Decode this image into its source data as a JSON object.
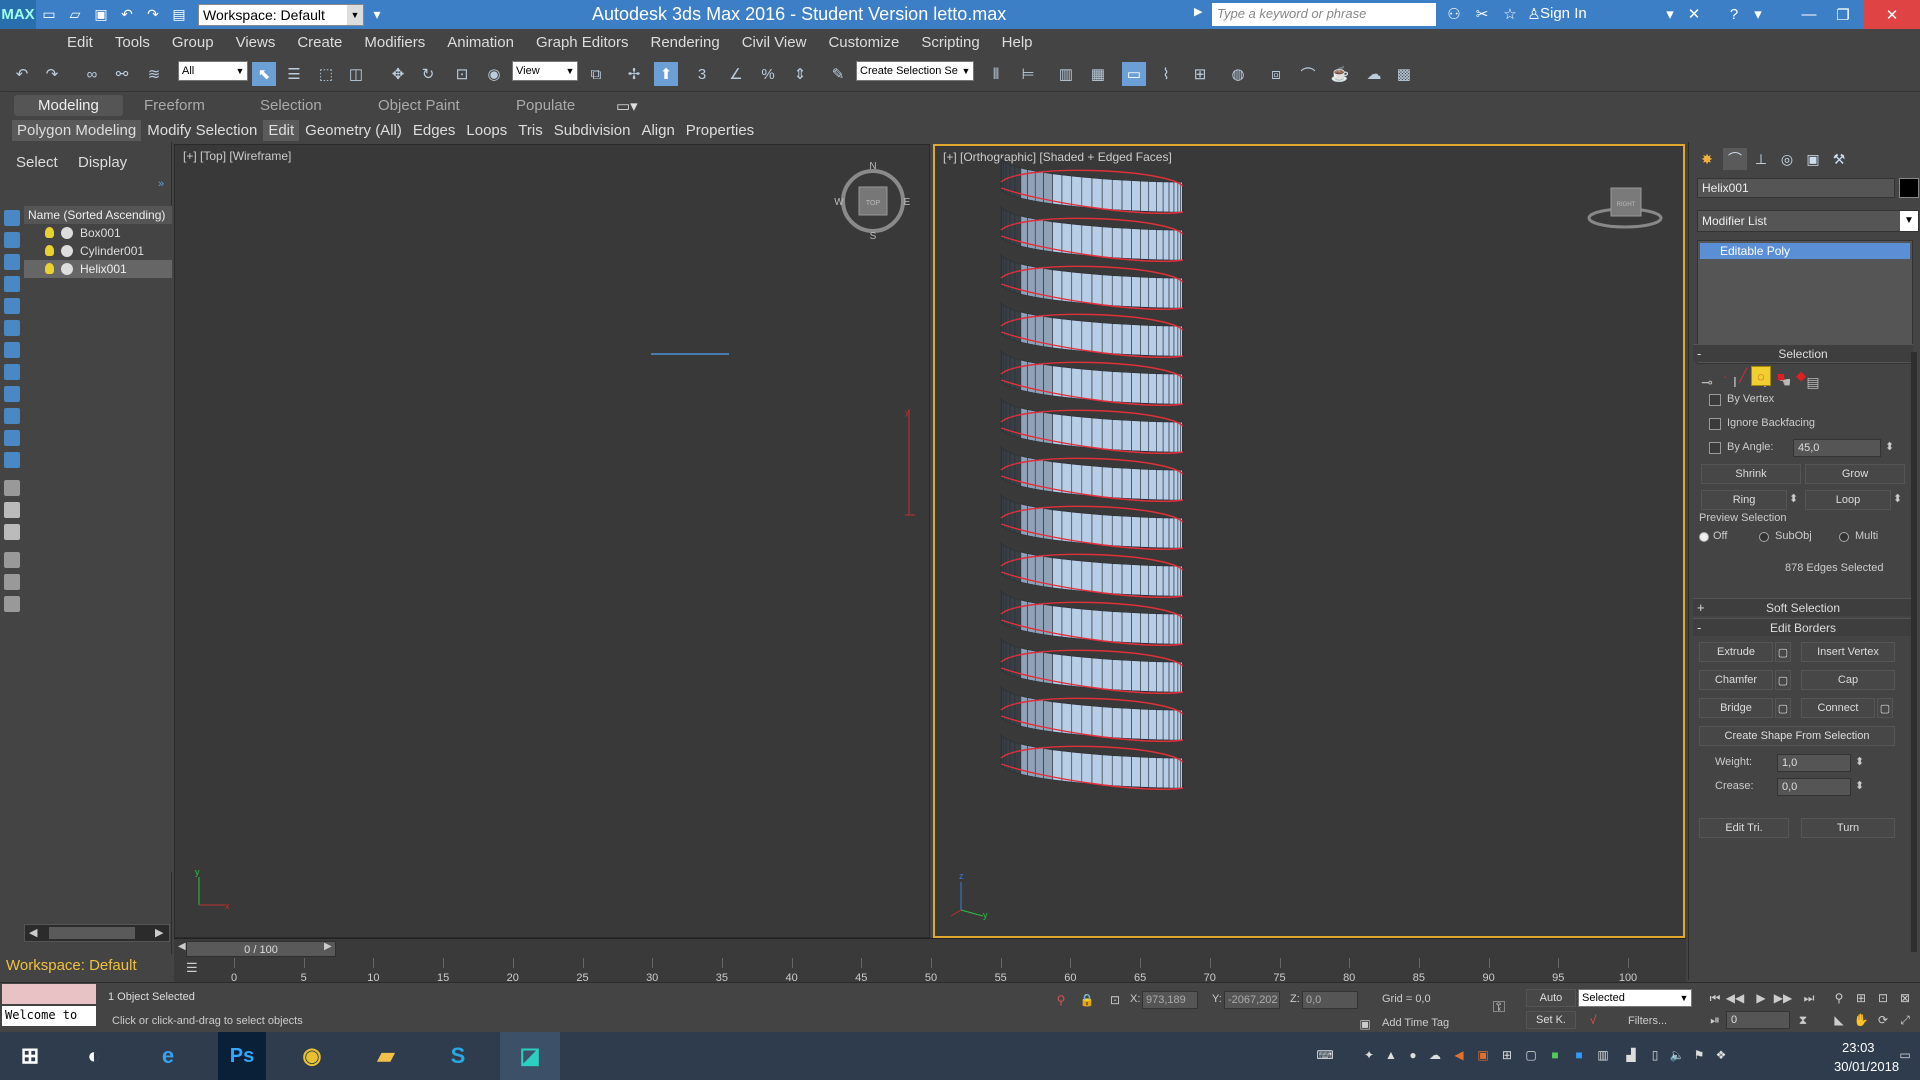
{
  "titlebar": {
    "workspace": "Workspace: Default",
    "title": "Autodesk 3ds Max 2016 - Student Version     letto.max",
    "search_placeholder": "Type a keyword or phrase",
    "signin": "Sign In",
    "app_logo": "MAX"
  },
  "menu": [
    "Edit",
    "Tools",
    "Group",
    "Views",
    "Create",
    "Modifiers",
    "Animation",
    "Graph Editors",
    "Rendering",
    "Civil View",
    "Customize",
    "Scripting",
    "Help"
  ],
  "toolbar": {
    "filter_value": "All",
    "refcoord_value": "View",
    "selset_value": "Create Selection Se",
    "snap_3": "3"
  },
  "ribbon": {
    "tabs": [
      "Modeling",
      "Freeform",
      "Selection",
      "Object Paint",
      "Populate"
    ],
    "subtabs": [
      "Polygon Modeling",
      "Modify Selection",
      "Edit",
      "Geometry (All)",
      "Edges",
      "Loops",
      "Tris",
      "Subdivision",
      "Align",
      "Properties"
    ]
  },
  "explorer": {
    "tab_select": "Select",
    "tab_display": "Display",
    "header": "Name (Sorted Ascending)",
    "items": [
      "Box001",
      "Cylinder001",
      "Helix001"
    ],
    "workspace_label": "Workspace: Default"
  },
  "viewports": {
    "top_label": "[+] [Top] [Wireframe]",
    "ortho_label": "[+] [Orthographic] [Shaded + Edged Faces]",
    "compass_n": "N",
    "compass_s": "S",
    "compass_e": "E",
    "compass_w": "W",
    "compass_center": "TOP",
    "viewcube_face": "RIGHT",
    "axis_x": "x",
    "axis_y": "y",
    "axis_z": "z"
  },
  "cmdpanel": {
    "object_name": "Helix001",
    "modifier_list": "Modifier List",
    "stack_item": "Editable Poly",
    "selection_header": "Selection",
    "by_vertex": "By Vertex",
    "ignore_backfacing": "Ignore Backfacing",
    "by_angle": "By Angle:",
    "by_angle_value": "45,0",
    "shrink": "Shrink",
    "grow": "Grow",
    "ring": "Ring",
    "loop": "Loop",
    "preview_selection": "Preview Selection",
    "preview_off": "Off",
    "preview_subobj": "SubObj",
    "preview_multi": "Multi",
    "selected_count": "878 Edges Selected",
    "soft_selection": "Soft Selection",
    "edit_borders": "Edit Borders",
    "extrude": "Extrude",
    "insert_vertex": "Insert Vertex",
    "chamfer": "Chamfer",
    "cap": "Cap",
    "bridge": "Bridge",
    "connect": "Connect",
    "create_shape": "Create Shape From Selection",
    "weight_label": "Weight:",
    "weight_value": "1,0",
    "crease_label": "Crease:",
    "crease_value": "0,0",
    "edit_tri": "Edit Tri.",
    "turn": "Turn",
    "plus": "+",
    "minus": "-"
  },
  "timeline": {
    "slider_text": "0 / 100",
    "ticks": [
      "0",
      "5",
      "10",
      "15",
      "20",
      "25",
      "30",
      "35",
      "40",
      "45",
      "50",
      "55",
      "60",
      "65",
      "70",
      "75",
      "80",
      "85",
      "90",
      "95",
      "100"
    ]
  },
  "status": {
    "maxscript_text": "Welcome to",
    "selection": "1 Object Selected",
    "prompt": "Click or click-and-drag to select objects",
    "x_label": "X:",
    "x_value": "973,189",
    "y_label": "Y:",
    "y_value": "-2067,202",
    "z_label": "Z:",
    "z_value": "0,0",
    "grid": "Grid = 0,0",
    "add_time_tag": "Add Time Tag",
    "auto": "Auto",
    "setk": "Set K.",
    "selected_dd": "Selected",
    "filters": "Filters...",
    "frame_value": "0"
  },
  "taskbar": {
    "time": "23:03",
    "date": "30/01/2018",
    "ps": "Ps"
  },
  "colors": {
    "titlebar": "#3c7fc6",
    "active_viewport_border": "#e0a82e",
    "helix_face": "#b8cde6",
    "edge_selected": "#e0303a"
  }
}
